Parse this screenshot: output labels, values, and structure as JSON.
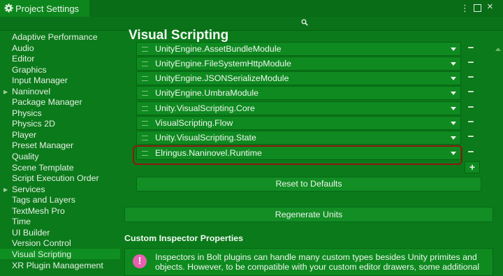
{
  "window": {
    "title": "Project Settings",
    "menu_icon": "⋮",
    "close_icon": "×"
  },
  "sidebar": {
    "items": [
      {
        "label": "Adaptive Performance"
      },
      {
        "label": "Audio"
      },
      {
        "label": "Editor"
      },
      {
        "label": "Graphics"
      },
      {
        "label": "Input Manager"
      },
      {
        "label": "Naninovel",
        "expandable": true
      },
      {
        "label": "Package Manager"
      },
      {
        "label": "Physics"
      },
      {
        "label": "Physics 2D"
      },
      {
        "label": "Player"
      },
      {
        "label": "Preset Manager"
      },
      {
        "label": "Quality"
      },
      {
        "label": "Scene Template"
      },
      {
        "label": "Script Execution Order"
      },
      {
        "label": "Services",
        "expandable": true
      },
      {
        "label": "Tags and Layers"
      },
      {
        "label": "TextMesh Pro"
      },
      {
        "label": "Time"
      },
      {
        "label": "UI Builder"
      },
      {
        "label": "Version Control"
      },
      {
        "label": "Visual Scripting",
        "selected": true
      },
      {
        "label": "XR Plugin Management"
      }
    ],
    "arrow_glyph": "▶"
  },
  "main": {
    "title": "Visual Scripting",
    "assemblies": [
      {
        "label": "UnityEngine.AssetBundleModule"
      },
      {
        "label": "UnityEngine.FileSystemHttpModule"
      },
      {
        "label": "UnityEngine.JSONSerializeModule"
      },
      {
        "label": "UnityEngine.UmbraModule"
      },
      {
        "label": "Unity.VisualScripting.Core"
      },
      {
        "label": "VisualScripting.Flow"
      },
      {
        "label": "Unity.VisualScripting.State"
      },
      {
        "label": "Elringus.Naninovel.Runtime",
        "highlighted": true
      }
    ],
    "remove_glyph": "−",
    "add_glyph": "+",
    "reset_label": "Reset to Defaults",
    "regenerate_label": "Regenerate Units",
    "section_title": "Custom Inspector Properties",
    "help_icon_glyph": "!",
    "help_lines": [
      "Inspectors in Bolt plugins can handle many custom types besides Unity primites and",
      "objects. However, to be compatible with your custom editor drawers, some additional"
    ]
  },
  "colors": {
    "background": "#0b7a1a",
    "highlight_border": "#8b1a12",
    "help_icon": "#e85fb0"
  }
}
